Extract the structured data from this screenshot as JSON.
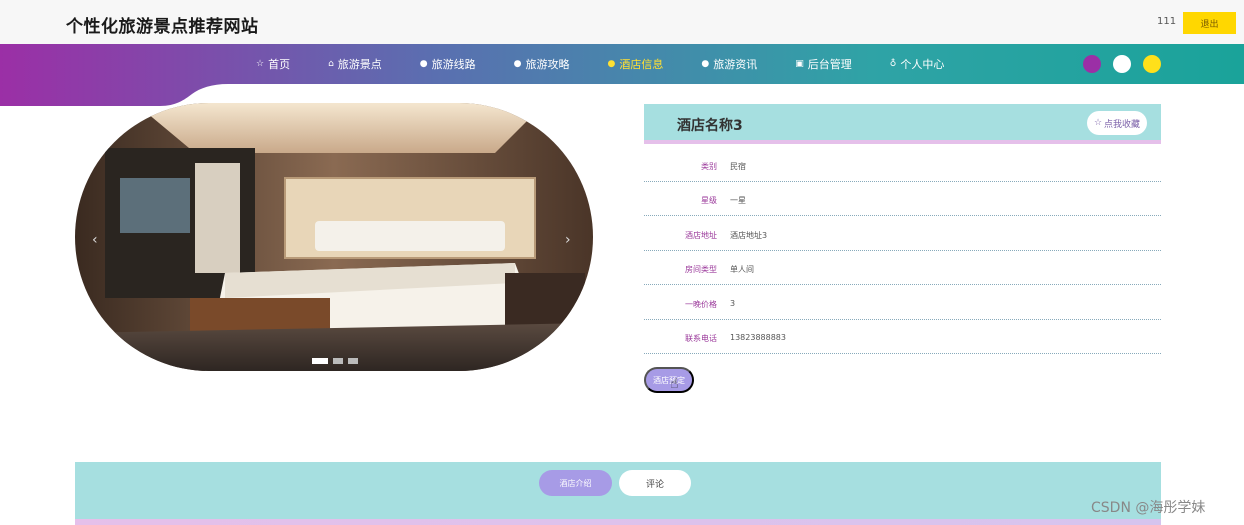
{
  "header": {
    "site_title": "个性化旅游景点推荐网站",
    "username": "111",
    "logout_label": "退出"
  },
  "nav": {
    "items": [
      {
        "icon": "☆",
        "label": "首页",
        "active": false
      },
      {
        "icon": "⌂",
        "label": "旅游景点",
        "active": false
      },
      {
        "icon": "●",
        "label": "旅游线路",
        "active": false
      },
      {
        "icon": "●",
        "label": "旅游攻略",
        "active": false
      },
      {
        "icon": "●",
        "label": "酒店信息",
        "active": true
      },
      {
        "icon": "●",
        "label": "旅游资讯",
        "active": false
      },
      {
        "icon": "▣",
        "label": "后台管理",
        "active": false
      },
      {
        "icon": "♁",
        "label": "个人中心",
        "active": false
      }
    ],
    "theme_colors": [
      "#9b2fa6",
      "#ffffff",
      "#ffe01a"
    ]
  },
  "carousel": {
    "prev_icon": "‹",
    "next_icon": "›",
    "slide_count": 3,
    "active_slide": 1
  },
  "detail": {
    "hotel_name": "酒店名称3",
    "favorite_icon": "☆",
    "favorite_label": "点我收藏",
    "attributes": [
      {
        "label": "类别",
        "value": "民宿"
      },
      {
        "label": "星级",
        "value": "一星"
      },
      {
        "label": "酒店地址",
        "value": "酒店地址3"
      },
      {
        "label": "房间类型",
        "value": "单人间"
      },
      {
        "label": "一晚价格",
        "value": "3"
      },
      {
        "label": "联系电话",
        "value": "13823888883"
      }
    ],
    "book_label": "酒店预定"
  },
  "tabs": {
    "intro_label": "酒店介绍",
    "comment_label": "评论"
  },
  "watermark": "CSDN @海彤学妹",
  "colors": {
    "accent_teal": "#1aa39a",
    "accent_purple": "#9b2fa6",
    "panel_teal": "#a6dfe0",
    "button_purple": "#a79be6",
    "logout_yellow": "#ffd700"
  }
}
